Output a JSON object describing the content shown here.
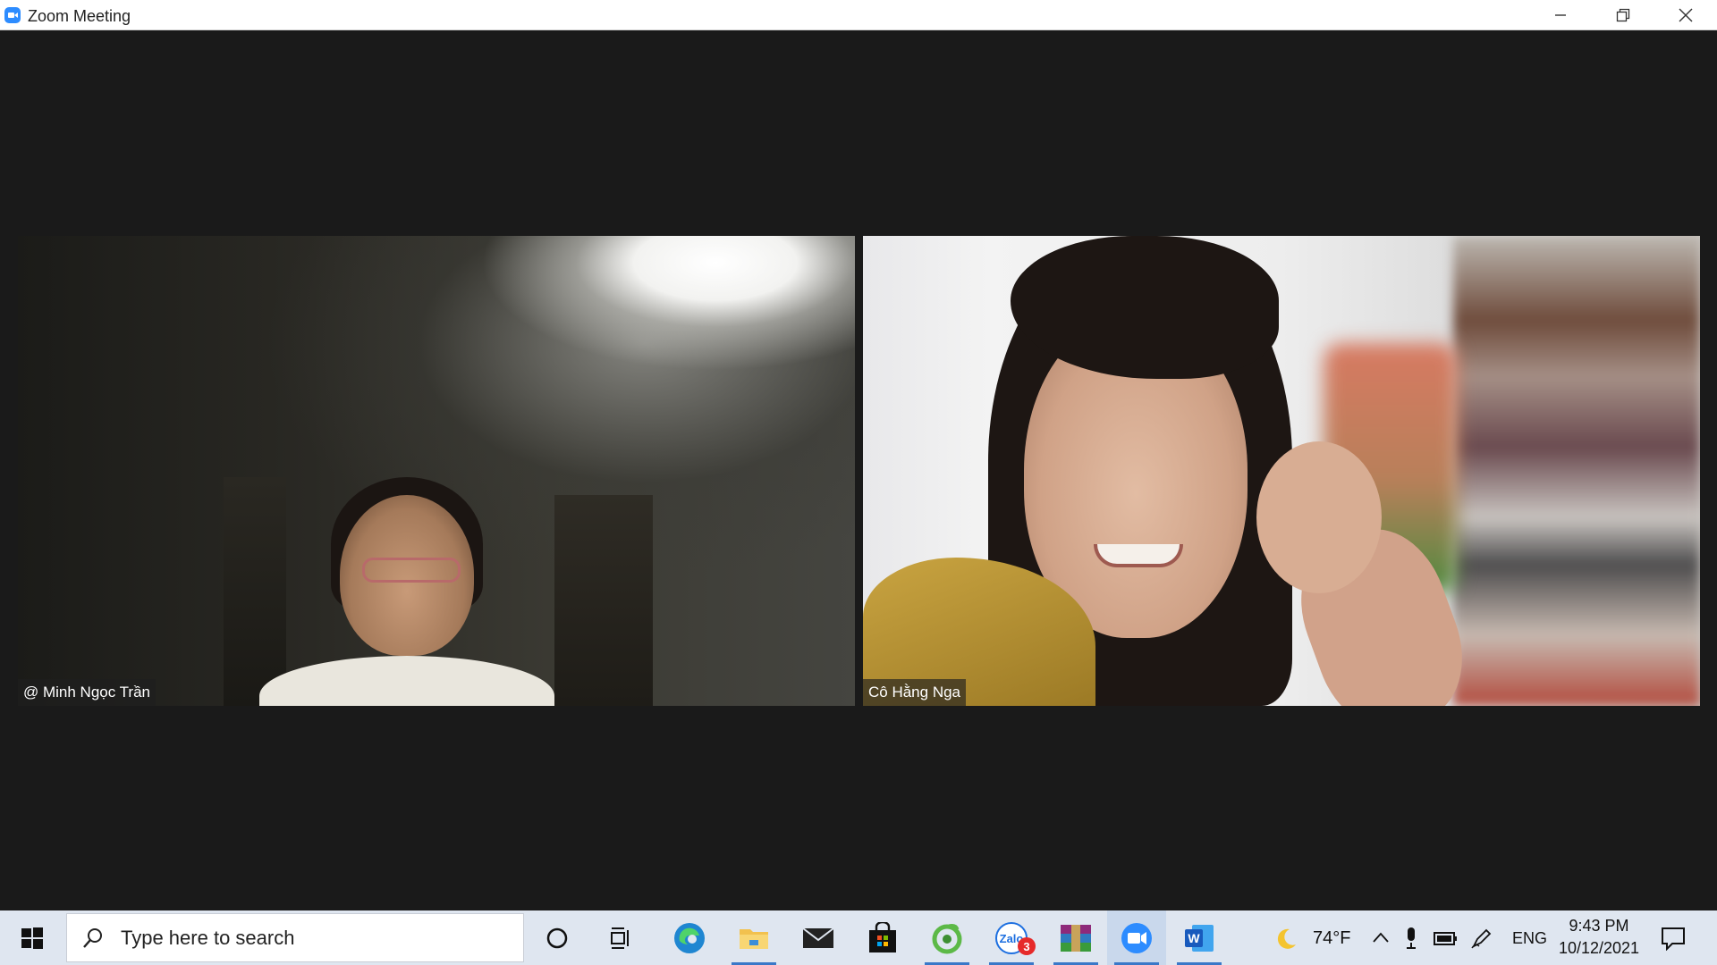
{
  "window": {
    "title": "Zoom Meeting",
    "icon": "zoom-icon",
    "controls": [
      "minimize-icon",
      "restore-icon",
      "close-icon"
    ]
  },
  "participants": [
    {
      "name": "@ Minh Ngọc Trần"
    },
    {
      "name": "Cô Hằng Nga"
    }
  ],
  "taskbar": {
    "search_placeholder": "Type here to search",
    "pinned": [
      "cortana-icon",
      "task-view-icon",
      "edge-icon",
      "file-explorer-icon",
      "mail-icon",
      "store-icon",
      "coccoc-icon",
      "zalo-icon",
      "winrar-icon",
      "zoom-icon",
      "word-icon"
    ],
    "zalo_badge": "3",
    "weather": {
      "icon": "moon-icon",
      "temperature": "74°F"
    },
    "language": "ENG",
    "time": "9:43 PM",
    "date": "10/12/2021"
  },
  "colors": {
    "stage_bg": "#1a1a1a",
    "taskbar_bg": "#dfe6f0",
    "accent": "#2d8cff"
  }
}
